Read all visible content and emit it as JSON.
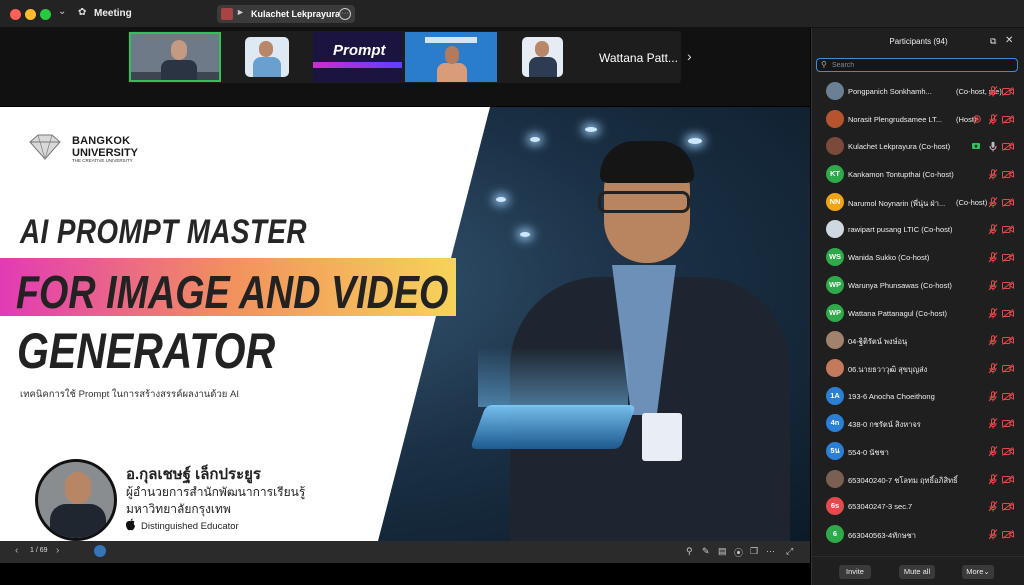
{
  "window": {
    "title": "Meeting",
    "share_text": "Kulachet Lekprayura's sc"
  },
  "video_strip": {
    "visible_name": "Wattana Patt..."
  },
  "slide": {
    "logo": {
      "line1": "BANGKOK",
      "line2": "UNIVERSITY",
      "tagline": "THE CREATIVE UNIVERSITY"
    },
    "title_line1": "AI PROMPT MASTER",
    "title_line2": "FOR IMAGE AND VIDEO",
    "title_line3": "GENERATOR",
    "subtitle": "เทคนิคการใช้ Prompt ในการสร้างสรรค์ผลงานด้วย AI",
    "presenter_name": "อ.กุลเชษฐ์ เล็กประยูร",
    "presenter_role1": "ผู้อำนวยการสำนักพัฒนาการเรียนรู้",
    "presenter_role2": "มหาวิทยาลัยกรุงเทพ",
    "award": "Distinguished Educator",
    "band_colors": [
      "#e23ab5",
      "#f2905e",
      "#f6d35a"
    ],
    "page_indicator": "1 / 69"
  },
  "participants": {
    "title": "Participants (94)",
    "search_placeholder": "Search",
    "items": [
      {
        "initials": "",
        "avatar_color": "#6b7f95",
        "name": "Pongpanich Sonkhamh...",
        "role": "(Co-host, me)",
        "mic": "muted",
        "cam": "off"
      },
      {
        "initials": "",
        "avatar_color": "#b5542f",
        "name": "Norasit Plengrudsamee LT...",
        "role": "(Host)",
        "mic": "muted",
        "cam": "off",
        "extra": "record"
      },
      {
        "initials": "",
        "avatar_color": "#7a4a3a",
        "name": "Kulachet Lekprayura (Co-host)",
        "role": "",
        "mic": "on",
        "cam": "off",
        "extra": "share"
      },
      {
        "initials": "KT",
        "avatar_color": "#2eaa4a",
        "name": "Kankamon Tontupthai (Co-host)",
        "role": "",
        "mic": "muted",
        "cam": "off"
      },
      {
        "initials": "NN",
        "avatar_color": "#f0a416",
        "name": "Narumol Noynarin (พี่นุ่น ฝ่า...",
        "role": "(Co-host)",
        "mic": "muted",
        "cam": "off"
      },
      {
        "initials": "",
        "avatar_color": "#cfd8e0",
        "name": "rawipart pusang LTIC (Co-host)",
        "role": "",
        "mic": "muted",
        "cam": "off"
      },
      {
        "initials": "WS",
        "avatar_color": "#2eaa4a",
        "name": "Wanida Sukko (Co-host)",
        "role": "",
        "mic": "muted",
        "cam": "off"
      },
      {
        "initials": "WP",
        "avatar_color": "#2eaa4a",
        "name": "Warunya Phunsawas (Co-host)",
        "role": "",
        "mic": "muted",
        "cam": "off"
      },
      {
        "initials": "WP",
        "avatar_color": "#2eaa4a",
        "name": "Wattana Pattanagul (Co-host)",
        "role": "",
        "mic": "muted",
        "cam": "off"
      },
      {
        "initials": "",
        "avatar_color": "#a0826d",
        "name": "04-ฐิติรัตน์ พงษ์อนุ",
        "role": "",
        "mic": "muted",
        "cam": "off"
      },
      {
        "initials": "",
        "avatar_color": "#c27a5a",
        "name": "06.นายธวาวุฒิ สุขบุญส่ง",
        "role": "",
        "mic": "muted",
        "cam": "off"
      },
      {
        "initials": "1A",
        "avatar_color": "#2b7fd6",
        "name": "193-6 Anocha Choeithong",
        "role": "",
        "mic": "muted",
        "cam": "off"
      },
      {
        "initials": "4n",
        "avatar_color": "#2b7fd6",
        "name": "438-0 กชรัตน์ สิงหาจร",
        "role": "",
        "mic": "muted",
        "cam": "off"
      },
      {
        "initials": "5น",
        "avatar_color": "#2b7fd6",
        "name": "554-0 นัชชา",
        "role": "",
        "mic": "muted",
        "cam": "off"
      },
      {
        "initials": "",
        "avatar_color": "#7a6050",
        "name": "653040240-7 ชโลทม ฤทธิ์อภิสิทธิ์",
        "role": "",
        "mic": "muted",
        "cam": "off"
      },
      {
        "initials": "6s",
        "avatar_color": "#e5484d",
        "name": "653040247-3 sec.7",
        "role": "",
        "mic": "muted",
        "cam": "off"
      },
      {
        "initials": "6",
        "avatar_color": "#2eaa4a",
        "name": "663040563-4ทักษชา",
        "role": "",
        "mic": "muted",
        "cam": "off"
      }
    ],
    "footer": {
      "invite": "Invite",
      "mute_all": "Mute all",
      "more": "More"
    }
  },
  "colors": {
    "accent": "#3a8dde",
    "muted_red": "#e5484d",
    "active_green": "#2ec15d"
  }
}
